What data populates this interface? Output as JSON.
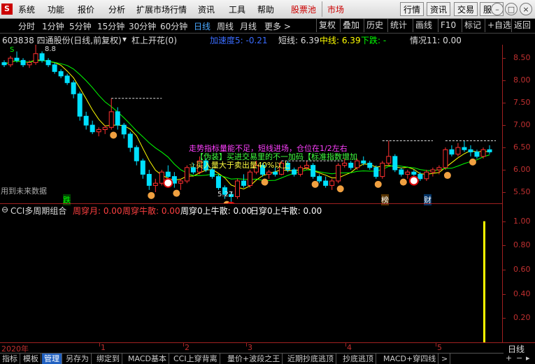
{
  "menu": {
    "items": [
      "系统",
      "功能",
      "报价",
      "分析",
      "扩展市场行情",
      "资讯",
      "工具",
      "帮助"
    ],
    "stock_pool": "股票池",
    "market": "市场",
    "right_buttons": [
      "行情",
      "资讯",
      "交易",
      "服务"
    ]
  },
  "toolbar": {
    "periods": [
      "分时",
      "1分钟",
      "5分钟",
      "15分钟",
      "30分钟",
      "60分钟",
      "日线",
      "周线",
      "月线",
      "更多 >"
    ],
    "active_period": "日线",
    "right_buttons": [
      "复权",
      "叠加",
      "历史",
      "统计",
      "画线",
      "F10",
      "标记",
      "+自选",
      "返回"
    ]
  },
  "info": {
    "stock": "603838 四通股份(日线,前复权)",
    "indicator_name": "杠上开花(0)",
    "speed": "加速度5: -0.21",
    "short_label": "短线: 6.39",
    "mid_label": "中线: 6.39",
    "down_label": "下跌: -",
    "situation": "情况11: 0.00"
  },
  "yaxis_main": [
    "8.50",
    "8.00",
    "7.50",
    "7.00",
    "6.50",
    "6.00",
    "5.50"
  ],
  "yaxis_sub": [
    "1.00",
    "0.80",
    "0.60",
    "0.40",
    "0.20"
  ],
  "annotations": {
    "future_data": "用到未来数据",
    "trend": "走势指标量能不足，短线进场，仓位在1/2左右",
    "fake": "【伪装】买进交易里的不一加码【标准指数增加",
    "buy": "☆买入量大于卖出量40%以上",
    "low_price": "5.27",
    "top_price": "8.8",
    "label_die": "跌",
    "label_bang": "榜",
    "label_cai": "财",
    "label_s": "S"
  },
  "sub": {
    "name": "CCI多周期组合",
    "f1": "周穿月: 0.00",
    "f2": "周穿牛散: 0.00",
    "f3": "周穿0上牛散: 0.00",
    "f4": "日穿0上牛散: 0.00"
  },
  "xaxis": {
    "year": "2020年",
    "months": [
      "1",
      "2",
      "3",
      "4",
      "5"
    ],
    "period": "日线"
  },
  "tabs": [
    "指标",
    "模板",
    "管理",
    "另存为",
    "绑定到",
    "MACD基本",
    "CCI上穿背离",
    "量价+波段之王",
    "近期抄底逃顶",
    "抄底逃顶",
    "MACD+穿四线",
    ">"
  ],
  "active_tab": "管理",
  "colors": {
    "up": "#ff3030",
    "down": "#00e0ff",
    "ma_yellow": "#ffff00",
    "ma_green": "#00ff00",
    "axis_red": "#c03030",
    "sub_bar": "#ffff00"
  },
  "chart_data": {
    "type": "candlestick",
    "title": "603838 四通股份(日线,前复权)",
    "ylim": [
      5.25,
      8.8
    ],
    "sub_ylim": [
      0,
      1.05
    ],
    "sub_bar": {
      "x_index": 77,
      "value": 1.0
    },
    "candles": [
      [
        8.4,
        8.45,
        8.3,
        8.35
      ],
      [
        8.35,
        8.55,
        8.3,
        8.5
      ],
      [
        8.5,
        8.65,
        8.4,
        8.45
      ],
      [
        8.45,
        8.5,
        8.3,
        8.35
      ],
      [
        8.35,
        8.45,
        8.28,
        8.4
      ],
      [
        8.4,
        8.8,
        8.35,
        8.6
      ],
      [
        8.6,
        8.65,
        8.4,
        8.45
      ],
      [
        8.45,
        8.5,
        8.3,
        8.35
      ],
      [
        8.35,
        8.4,
        8.15,
        8.2
      ],
      [
        8.2,
        8.25,
        8.05,
        8.1
      ],
      [
        8.1,
        8.15,
        7.9,
        7.95
      ],
      [
        7.95,
        8.0,
        7.6,
        7.7
      ],
      [
        7.7,
        7.75,
        7.1,
        7.2
      ],
      [
        7.2,
        7.3,
        6.9,
        7.0
      ],
      [
        7.0,
        7.1,
        6.8,
        6.85
      ],
      [
        6.85,
        6.95,
        6.75,
        6.9
      ],
      [
        6.9,
        7.0,
        6.8,
        6.95
      ],
      [
        6.95,
        7.6,
        6.9,
        7.3
      ],
      [
        7.3,
        7.4,
        6.9,
        7.0
      ],
      [
        7.0,
        7.05,
        6.7,
        6.8
      ],
      [
        6.8,
        6.85,
        6.4,
        6.5
      ],
      [
        6.5,
        6.55,
        6.1,
        6.2
      ],
      [
        6.2,
        6.25,
        5.8,
        5.9
      ],
      [
        5.9,
        6.0,
        5.55,
        5.65
      ],
      [
        5.65,
        5.8,
        5.5,
        5.7
      ],
      [
        5.7,
        6.0,
        5.65,
        5.95
      ],
      [
        5.95,
        6.1,
        5.8,
        5.85
      ],
      [
        5.85,
        5.95,
        5.6,
        5.7
      ],
      [
        5.7,
        5.8,
        5.55,
        5.75
      ],
      [
        5.75,
        6.1,
        5.7,
        6.05
      ],
      [
        6.05,
        6.15,
        5.9,
        5.95
      ],
      [
        5.95,
        6.3,
        5.9,
        6.2
      ],
      [
        6.2,
        6.25,
        5.95,
        6.0
      ],
      [
        6.0,
        6.05,
        5.8,
        5.85
      ],
      [
        5.85,
        5.9,
        5.55,
        5.6
      ],
      [
        5.6,
        5.65,
        5.35,
        5.45
      ],
      [
        5.45,
        5.5,
        5.27,
        5.4
      ],
      [
        5.4,
        5.8,
        5.35,
        5.75
      ],
      [
        5.75,
        5.9,
        5.6,
        5.65
      ],
      [
        5.65,
        6.0,
        5.6,
        5.95
      ],
      [
        5.95,
        6.2,
        5.9,
        6.1
      ],
      [
        6.1,
        6.15,
        5.85,
        5.9
      ],
      [
        5.9,
        6.0,
        5.8,
        5.95
      ],
      [
        5.95,
        6.05,
        5.85,
        5.9
      ],
      [
        5.9,
        6.2,
        5.88,
        6.15
      ],
      [
        6.15,
        6.2,
        5.95,
        6.0
      ],
      [
        6.0,
        6.05,
        5.85,
        5.9
      ],
      [
        5.9,
        6.1,
        5.85,
        6.05
      ],
      [
        6.05,
        6.2,
        6.0,
        6.1
      ],
      [
        6.1,
        6.15,
        5.8,
        5.85
      ],
      [
        5.85,
        5.9,
        5.7,
        5.75
      ],
      [
        5.75,
        5.85,
        5.6,
        5.65
      ],
      [
        5.65,
        5.8,
        5.55,
        5.75
      ],
      [
        5.75,
        6.15,
        5.7,
        6.1
      ],
      [
        6.1,
        6.25,
        6.05,
        6.15
      ],
      [
        6.15,
        6.2,
        6.0,
        6.05
      ],
      [
        6.05,
        6.25,
        6.0,
        6.2
      ],
      [
        6.2,
        6.3,
        6.1,
        6.15
      ],
      [
        6.15,
        6.2,
        6.0,
        6.05
      ],
      [
        6.05,
        6.1,
        5.8,
        5.85
      ],
      [
        5.85,
        6.2,
        5.8,
        6.15
      ],
      [
        6.15,
        6.65,
        6.1,
        6.3
      ],
      [
        6.3,
        6.35,
        5.95,
        6.0
      ],
      [
        6.0,
        6.05,
        5.85,
        5.9
      ],
      [
        5.9,
        6.0,
        5.8,
        5.95
      ],
      [
        5.95,
        6.0,
        5.85,
        5.9
      ],
      [
        5.9,
        5.95,
        5.75,
        5.8
      ],
      [
        5.8,
        6.0,
        5.75,
        5.95
      ],
      [
        5.95,
        6.05,
        5.85,
        6.0
      ],
      [
        6.0,
        6.1,
        5.9,
        6.05
      ],
      [
        6.05,
        6.5,
        6.0,
        6.45
      ],
      [
        6.45,
        6.55,
        6.3,
        6.35
      ],
      [
        6.35,
        6.6,
        6.3,
        6.5
      ],
      [
        6.5,
        6.65,
        6.4,
        6.45
      ],
      [
        6.45,
        6.55,
        6.3,
        6.4
      ],
      [
        6.4,
        6.45,
        6.25,
        6.3
      ],
      [
        6.3,
        6.5,
        6.25,
        6.45
      ],
      [
        6.45,
        6.55,
        6.35,
        6.4
      ]
    ]
  }
}
